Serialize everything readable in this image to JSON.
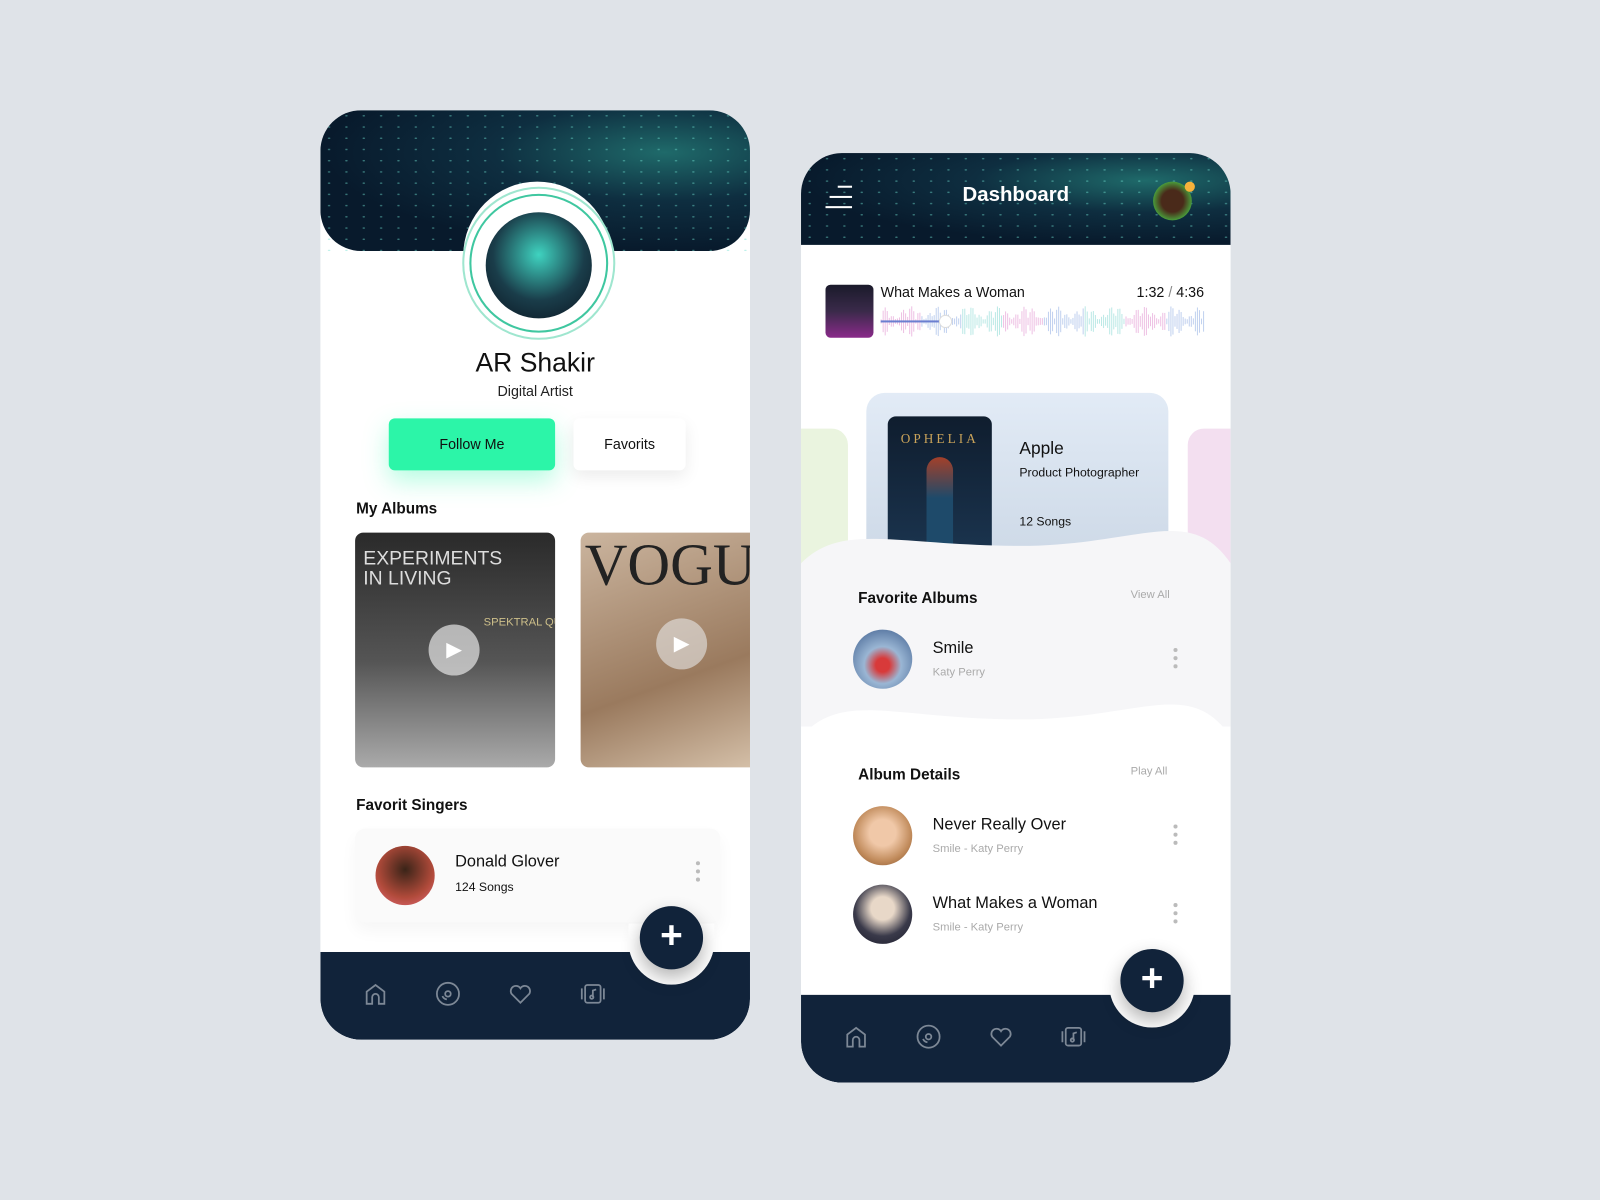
{
  "profile": {
    "name": "AR Shakir",
    "role": "Digital Artist",
    "follow_label": "Follow Me",
    "favorits_label": "Favorits",
    "albums_title": "My Albums",
    "albums": [
      {
        "title": "EXPERIMENTS IN LIVING",
        "subtitle": "SPEKTRAL QUARTET"
      },
      {
        "title": "VOGUE"
      }
    ],
    "singers_title": "Favorit Singers",
    "singers": [
      {
        "name": "Donald Glover",
        "songs": "124 Songs"
      }
    ],
    "nav": [
      "home-icon",
      "disc-icon",
      "heart-icon",
      "music-library-icon"
    ]
  },
  "dashboard": {
    "title": "Dashboard",
    "player": {
      "track": "What Makes a Woman",
      "elapsed": "1:32",
      "sep": "/",
      "total": "4:36",
      "progress": 0.2
    },
    "featured": {
      "cover_title": "OPHELIA",
      "name": "Apple",
      "role": "Product Photographer",
      "songs": "12 Songs"
    },
    "favorite_albums": {
      "title": "Favorite Albums",
      "action": "View All",
      "items": [
        {
          "title": "Smile",
          "artist": "Katy Perry"
        }
      ]
    },
    "album_details": {
      "title": "Album Details",
      "action": "Play All",
      "items": [
        {
          "title": "Never Really Over",
          "subtitle": "Smile - Katy Perry"
        },
        {
          "title": "What Makes a Woman",
          "subtitle": "Smile - Katy Perry"
        }
      ]
    }
  },
  "colors": {
    "accent": "#2cf5a8",
    "navy": "#11233a",
    "background": "#dfe3e8"
  }
}
